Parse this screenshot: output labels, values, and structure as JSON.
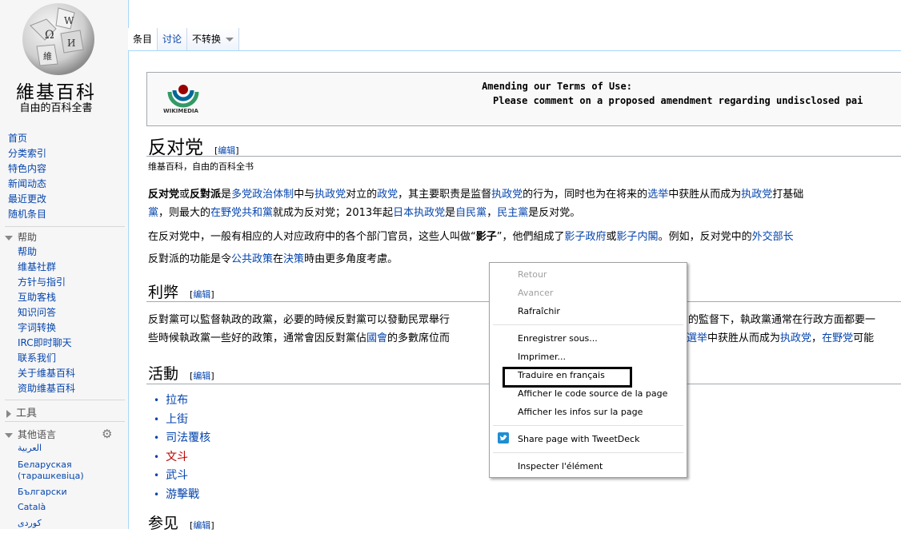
{
  "logo": {
    "title": "維基百科",
    "subtitle": "自由的百科全書"
  },
  "nav_main": [
    "首页",
    "分类索引",
    "特色内容",
    "新闻动态",
    "最近更改",
    "随机条目"
  ],
  "help": {
    "title": "帮助",
    "items": [
      "帮助",
      "维基社群",
      "方针与指引",
      "互助客栈",
      "知识问答",
      "字词转换",
      "IRC即时聊天",
      "联系我们",
      "关于维基百科",
      "资助维基百科"
    ]
  },
  "tools": {
    "title": "工具"
  },
  "languages": {
    "title": "其他语言",
    "items": [
      "العربية",
      "Беларуская (тарашкевіца)",
      "Български",
      "Català",
      "کوردی"
    ]
  },
  "tabs": {
    "article": "条目",
    "talk": "讨论",
    "variant": "不转换"
  },
  "banner": {
    "logo_text": "WIKIMEDIA",
    "line1": "Amending our Terms of Use:",
    "line2": "Please comment on a proposed amendment regarding undisclosed pai"
  },
  "article": {
    "title": "反对党",
    "edit": "编辑",
    "tagline": "维基百科，自由的百科全书",
    "p1a": [
      "反对党",
      "或",
      "反對派",
      "是",
      "多党政治体制",
      "中与",
      "执政党",
      "对立的",
      "政党",
      "，其主要职责是监督",
      "执政党",
      "的行为，同时也为在将来的",
      "选举",
      "中获胜从而成为",
      "执政党",
      "打基础"
    ],
    "p1b": [
      "黨",
      "，则最大的",
      "在野党共和黨",
      "就成为反对党；2013年起",
      "日本执政党",
      "是",
      "自民黨",
      "，",
      "民主黨",
      "是反对党。"
    ],
    "p2": [
      "在反对党中，一般有相应的人对应政府中的各个部门官员，这些人叫做“",
      "影子",
      "”，他們組成了",
      "影子政府",
      "或",
      "影子内閣",
      "。例如，反对党中的",
      "外交部长"
    ],
    "p3": [
      "反對派的功能是令",
      "公共政策",
      "在",
      "決策",
      "時由更多角度考慮。"
    ],
    "s1": "利弊",
    "s1p1": "反對黨可以監督執政的政黨，必要的時候反對黨可以發動民眾舉行",
    "s1p1r": "的監督下，執政黨通常在行政方面都要一",
    "s1p2": [
      "些時候執政黨一些好的政策，通常會因反對黨佔",
      "國會",
      "的多數席位而"
    ],
    "s1p2r": [
      "選举",
      "中获胜从而成为",
      "执政党",
      "，",
      "在野党",
      "可能"
    ],
    "s2": "活動",
    "acts": [
      "拉布",
      "上街",
      "司法覆核",
      "文斗",
      "武斗",
      "游擊戰"
    ],
    "s3": "参见"
  },
  "context_menu": {
    "back": "Retour",
    "forward": "Avancer",
    "reload": "Rafraîchir",
    "save": "Enregistrer sous...",
    "print": "Imprimer...",
    "translate": "Traduire en français",
    "source": "Afficher le code source de la page",
    "info": "Afficher les infos sur la page",
    "tweetdeck": "Share page with TweetDeck",
    "inspect": "Inspecter l'élément"
  }
}
